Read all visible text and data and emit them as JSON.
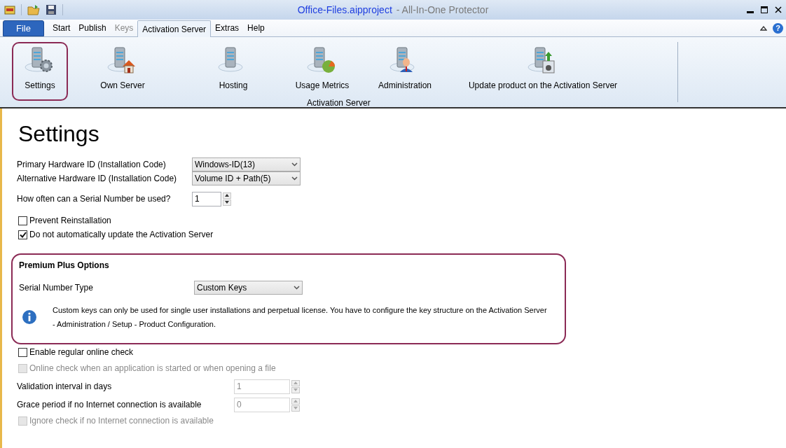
{
  "window": {
    "file_name": "Office-Files.aipproject",
    "app_name": "- All-In-One Protector"
  },
  "help_glyph": "?",
  "tabs": [
    {
      "label": "File",
      "kind": "file",
      "selected": false
    },
    {
      "label": "Start",
      "kind": "tab",
      "selected": false,
      "disabled": false
    },
    {
      "label": "Publish",
      "kind": "tab",
      "selected": false,
      "disabled": false
    },
    {
      "label": "Keys",
      "kind": "tab",
      "selected": false,
      "disabled": true
    },
    {
      "label": "Activation Server",
      "kind": "tab",
      "selected": true,
      "disabled": false
    },
    {
      "label": "Extras",
      "kind": "tab",
      "selected": false,
      "disabled": false
    },
    {
      "label": "Help",
      "kind": "tab",
      "selected": false,
      "disabled": false
    }
  ],
  "ribbon": {
    "group_label": "Activation Server",
    "buttons": [
      {
        "label": "Settings",
        "kind": "gear",
        "selected": true
      },
      {
        "label": "Own Server",
        "kind": "house",
        "selected": false
      },
      {
        "label": "Hosting",
        "kind": "plain",
        "selected": false
      },
      {
        "label": "Usage Metrics",
        "kind": "pie",
        "selected": false
      },
      {
        "label": "Administration",
        "kind": "person",
        "selected": false
      },
      {
        "label": "Update product on the Activation Server",
        "kind": "upload",
        "selected": false
      }
    ]
  },
  "heading": "Settings",
  "upper_rows": [
    {
      "kind": "select",
      "label": "Primary Hardware ID (Installation Code)",
      "value": "Windows-ID(13)"
    },
    {
      "kind": "select",
      "label": "Alternative Hardware ID (Installation Code)",
      "value": "Volume ID + Path(5)"
    },
    {
      "kind": "spinner",
      "label": "How often can a Serial Number be used?",
      "value": "1",
      "disabled": false
    },
    {
      "kind": "checkbox",
      "label": "Prevent Reinstallation",
      "checked": false,
      "disabled": false
    },
    {
      "kind": "checkbox",
      "label": "Do not automatically update the Activation Server",
      "checked": true,
      "disabled": false
    }
  ],
  "premium": {
    "title": "Premium Plus Options",
    "serial_label": "Serial Number Type",
    "serial_value": "Custom Keys",
    "info_lines": [
      "Custom keys can only be used for single user installations and perpetual license. You have to configure the key structure on the Activation Server",
      "- Administration / Setup - Product Configuration."
    ]
  },
  "lower_rows": [
    {
      "kind": "checkbox",
      "label": "Enable regular online check",
      "checked": false,
      "disabled": false
    },
    {
      "kind": "checkbox",
      "label": "Online check when an application is started or when opening a file",
      "checked": false,
      "disabled": true
    },
    {
      "kind": "spinner",
      "label": "Validation interval in days",
      "value": "1",
      "disabled": true
    },
    {
      "kind": "spinner",
      "label": "Grace period if no Internet connection is available",
      "value": "0",
      "disabled": true
    },
    {
      "kind": "checkbox",
      "label": "Ignore check if no Internet connection is available",
      "checked": false,
      "disabled": true
    }
  ]
}
